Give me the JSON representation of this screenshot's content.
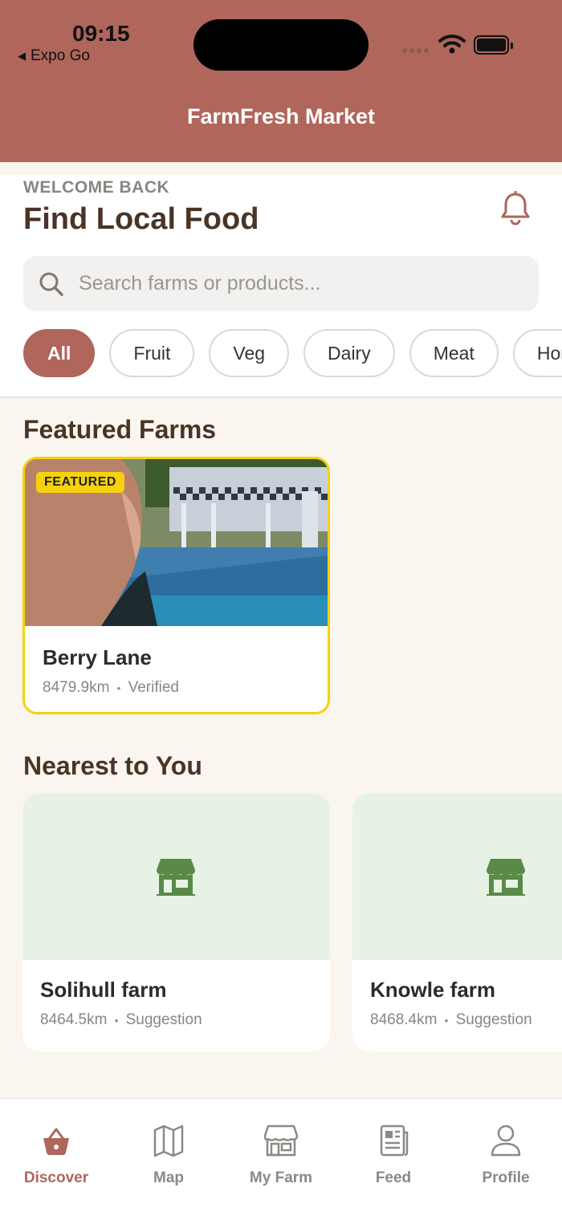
{
  "status_bar": {
    "time": "09:15",
    "back_app": "Expo Go"
  },
  "header": {
    "title": "FarmFresh Market"
  },
  "welcome": {
    "eyebrow": "WELCOME BACK",
    "title": "Find Local Food"
  },
  "search": {
    "placeholder": "Search farms or products..."
  },
  "categories": [
    {
      "label": "All",
      "active": true
    },
    {
      "label": "Fruit"
    },
    {
      "label": "Veg"
    },
    {
      "label": "Dairy"
    },
    {
      "label": "Meat"
    },
    {
      "label": "Honey"
    }
  ],
  "featured": {
    "section_title": "Featured Farms",
    "cards": [
      {
        "badge": "FEATURED",
        "name": "Berry Lane",
        "distance": "8479.9km",
        "status": "Verified"
      }
    ]
  },
  "nearest": {
    "section_title": "Nearest to You",
    "cards": [
      {
        "name": "Solihull farm",
        "distance": "8464.5km",
        "status": "Suggestion"
      },
      {
        "name": "Knowle farm",
        "distance": "8468.4km",
        "status": "Suggestion"
      }
    ]
  },
  "bottom_nav": [
    {
      "label": "Discover",
      "icon": "basket-icon",
      "active": true
    },
    {
      "label": "Map",
      "icon": "map-icon"
    },
    {
      "label": "My Farm",
      "icon": "storefront-icon"
    },
    {
      "label": "Feed",
      "icon": "newspaper-icon"
    },
    {
      "label": "Profile",
      "icon": "person-icon"
    }
  ],
  "colors": {
    "brand": "#b0665b",
    "featured_border": "#f5d20b",
    "farm_thumb_bg": "#e6f3e4",
    "farm_icon": "#5a8a48",
    "heading": "#4a3426",
    "page_bg": "#faf6ef"
  },
  "separator": "•"
}
